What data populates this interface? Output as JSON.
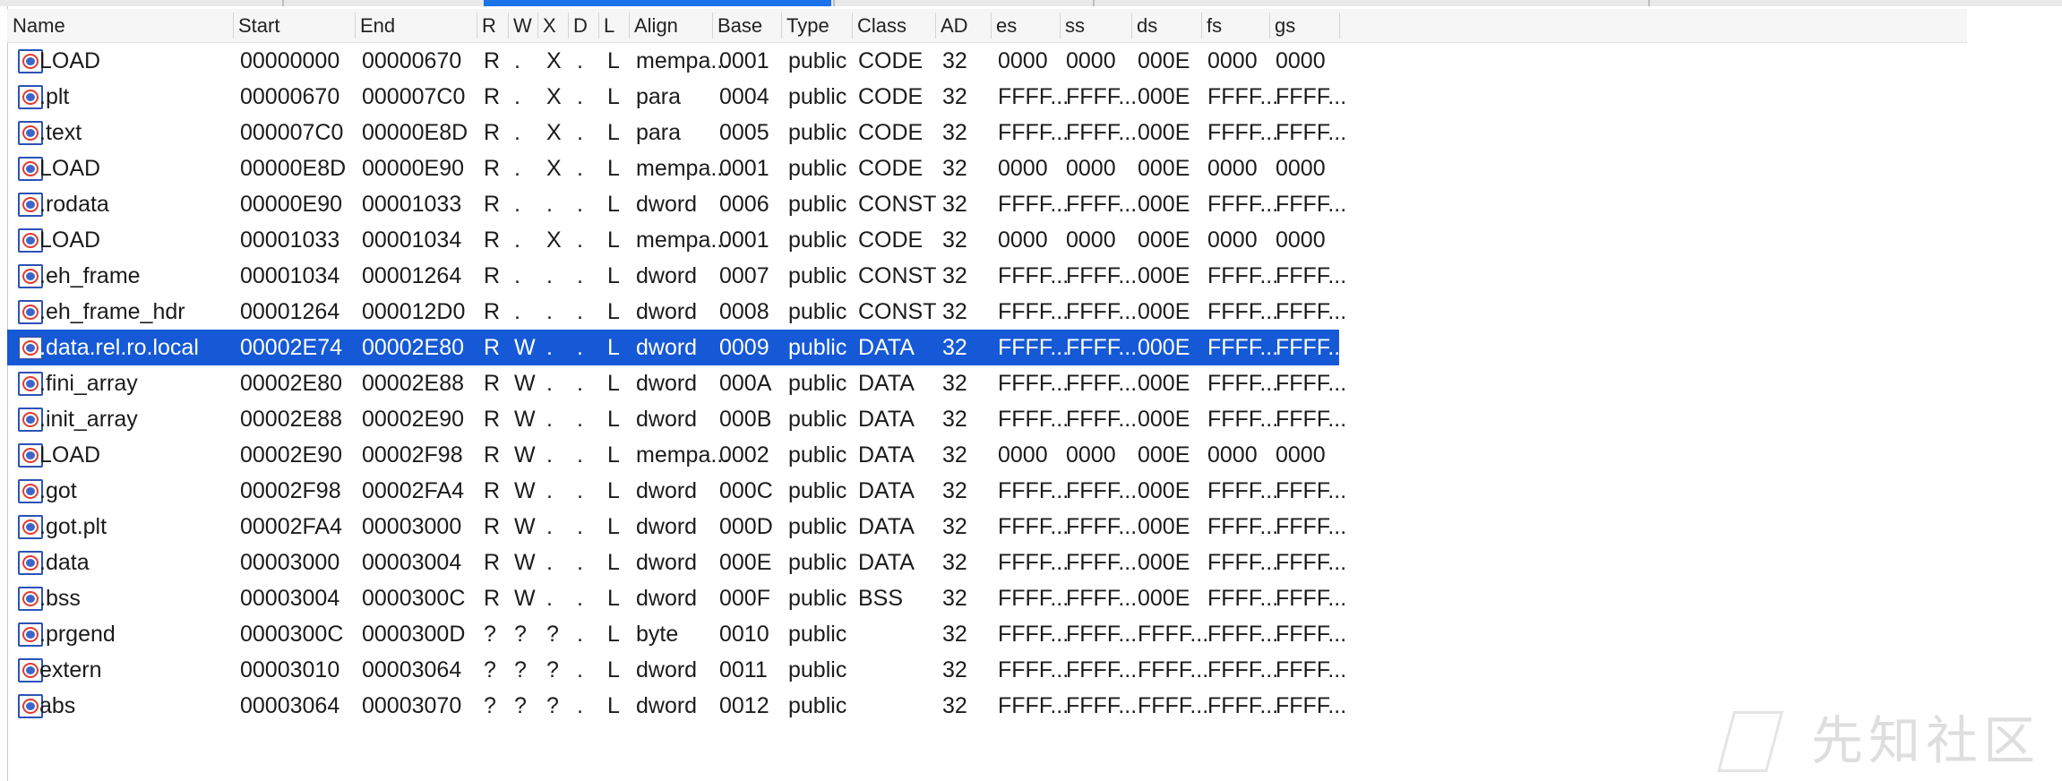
{
  "columns": [
    "Name",
    "Start",
    "End",
    "R",
    "W",
    "X",
    "D",
    "L",
    "Align",
    "Base",
    "Type",
    "Class",
    "AD",
    "es",
    "ss",
    "ds",
    "fs",
    "gs"
  ],
  "rows": [
    {
      "name": "LOAD",
      "start": "00000000",
      "end": "00000670",
      "r": "R",
      "w": ".",
      "x": "X",
      "d": ".",
      "l": "L",
      "align": "mempa...",
      "base": "0001",
      "type": "public",
      "class": "CODE",
      "ad": "32",
      "es": "0000",
      "ss": "0000",
      "ds": "000E",
      "fs": "0000",
      "gs": "0000"
    },
    {
      "name": ".plt",
      "start": "00000670",
      "end": "000007C0",
      "r": "R",
      "w": ".",
      "x": "X",
      "d": ".",
      "l": "L",
      "align": "para",
      "base": "0004",
      "type": "public",
      "class": "CODE",
      "ad": "32",
      "es": "FFFF...",
      "ss": "FFFF...",
      "ds": "000E",
      "fs": "FFFF...",
      "gs": "FFFF..."
    },
    {
      "name": ".text",
      "start": "000007C0",
      "end": "00000E8D",
      "r": "R",
      "w": ".",
      "x": "X",
      "d": ".",
      "l": "L",
      "align": "para",
      "base": "0005",
      "type": "public",
      "class": "CODE",
      "ad": "32",
      "es": "FFFF...",
      "ss": "FFFF...",
      "ds": "000E",
      "fs": "FFFF...",
      "gs": "FFFF..."
    },
    {
      "name": "LOAD",
      "start": "00000E8D",
      "end": "00000E90",
      "r": "R",
      "w": ".",
      "x": "X",
      "d": ".",
      "l": "L",
      "align": "mempa...",
      "base": "0001",
      "type": "public",
      "class": "CODE",
      "ad": "32",
      "es": "0000",
      "ss": "0000",
      "ds": "000E",
      "fs": "0000",
      "gs": "0000"
    },
    {
      "name": ".rodata",
      "start": "00000E90",
      "end": "00001033",
      "r": "R",
      "w": ".",
      "x": ".",
      "d": ".",
      "l": "L",
      "align": "dword",
      "base": "0006",
      "type": "public",
      "class": "CONST",
      "ad": "32",
      "es": "FFFF...",
      "ss": "FFFF...",
      "ds": "000E",
      "fs": "FFFF...",
      "gs": "FFFF..."
    },
    {
      "name": "LOAD",
      "start": "00001033",
      "end": "00001034",
      "r": "R",
      "w": ".",
      "x": "X",
      "d": ".",
      "l": "L",
      "align": "mempa...",
      "base": "0001",
      "type": "public",
      "class": "CODE",
      "ad": "32",
      "es": "0000",
      "ss": "0000",
      "ds": "000E",
      "fs": "0000",
      "gs": "0000"
    },
    {
      "name": ".eh_frame",
      "start": "00001034",
      "end": "00001264",
      "r": "R",
      "w": ".",
      "x": ".",
      "d": ".",
      "l": "L",
      "align": "dword",
      "base": "0007",
      "type": "public",
      "class": "CONST",
      "ad": "32",
      "es": "FFFF...",
      "ss": "FFFF...",
      "ds": "000E",
      "fs": "FFFF...",
      "gs": "FFFF..."
    },
    {
      "name": ".eh_frame_hdr",
      "start": "00001264",
      "end": "000012D0",
      "r": "R",
      "w": ".",
      "x": ".",
      "d": ".",
      "l": "L",
      "align": "dword",
      "base": "0008",
      "type": "public",
      "class": "CONST",
      "ad": "32",
      "es": "FFFF...",
      "ss": "FFFF...",
      "ds": "000E",
      "fs": "FFFF...",
      "gs": "FFFF..."
    },
    {
      "name": ".data.rel.ro.local",
      "start": "00002E74",
      "end": "00002E80",
      "r": "R",
      "w": "W",
      "x": ".",
      "d": ".",
      "l": "L",
      "align": "dword",
      "base": "0009",
      "type": "public",
      "class": "DATA",
      "ad": "32",
      "es": "FFFF...",
      "ss": "FFFF...",
      "ds": "000E",
      "fs": "FFFF...",
      "gs": "FFFF...",
      "selected": true
    },
    {
      "name": ".fini_array",
      "start": "00002E80",
      "end": "00002E88",
      "r": "R",
      "w": "W",
      "x": ".",
      "d": ".",
      "l": "L",
      "align": "dword",
      "base": "000A",
      "type": "public",
      "class": "DATA",
      "ad": "32",
      "es": "FFFF...",
      "ss": "FFFF...",
      "ds": "000E",
      "fs": "FFFF...",
      "gs": "FFFF..."
    },
    {
      "name": ".init_array",
      "start": "00002E88",
      "end": "00002E90",
      "r": "R",
      "w": "W",
      "x": ".",
      "d": ".",
      "l": "L",
      "align": "dword",
      "base": "000B",
      "type": "public",
      "class": "DATA",
      "ad": "32",
      "es": "FFFF...",
      "ss": "FFFF...",
      "ds": "000E",
      "fs": "FFFF...",
      "gs": "FFFF..."
    },
    {
      "name": "LOAD",
      "start": "00002E90",
      "end": "00002F98",
      "r": "R",
      "w": "W",
      "x": ".",
      "d": ".",
      "l": "L",
      "align": "mempa...",
      "base": "0002",
      "type": "public",
      "class": "DATA",
      "ad": "32",
      "es": "0000",
      "ss": "0000",
      "ds": "000E",
      "fs": "0000",
      "gs": "0000"
    },
    {
      "name": ".got",
      "start": "00002F98",
      "end": "00002FA4",
      "r": "R",
      "w": "W",
      "x": ".",
      "d": ".",
      "l": "L",
      "align": "dword",
      "base": "000C",
      "type": "public",
      "class": "DATA",
      "ad": "32",
      "es": "FFFF...",
      "ss": "FFFF...",
      "ds": "000E",
      "fs": "FFFF...",
      "gs": "FFFF..."
    },
    {
      "name": ".got.plt",
      "start": "00002FA4",
      "end": "00003000",
      "r": "R",
      "w": "W",
      "x": ".",
      "d": ".",
      "l": "L",
      "align": "dword",
      "base": "000D",
      "type": "public",
      "class": "DATA",
      "ad": "32",
      "es": "FFFF...",
      "ss": "FFFF...",
      "ds": "000E",
      "fs": "FFFF...",
      "gs": "FFFF..."
    },
    {
      "name": ".data",
      "start": "00003000",
      "end": "00003004",
      "r": "R",
      "w": "W",
      "x": ".",
      "d": ".",
      "l": "L",
      "align": "dword",
      "base": "000E",
      "type": "public",
      "class": "DATA",
      "ad": "32",
      "es": "FFFF...",
      "ss": "FFFF...",
      "ds": "000E",
      "fs": "FFFF...",
      "gs": "FFFF..."
    },
    {
      "name": ".bss",
      "start": "00003004",
      "end": "0000300C",
      "r": "R",
      "w": "W",
      "x": ".",
      "d": ".",
      "l": "L",
      "align": "dword",
      "base": "000F",
      "type": "public",
      "class": "BSS",
      "ad": "32",
      "es": "FFFF...",
      "ss": "FFFF...",
      "ds": "000E",
      "fs": "FFFF...",
      "gs": "FFFF..."
    },
    {
      "name": ".prgend",
      "start": "0000300C",
      "end": "0000300D",
      "r": "?",
      "w": "?",
      "x": "?",
      "d": ".",
      "l": "L",
      "align": "byte",
      "base": "0010",
      "type": "public",
      "class": "",
      "ad": "32",
      "es": "FFFF...",
      "ss": "FFFF...",
      "ds": "FFFF...",
      "fs": "FFFF...",
      "gs": "FFFF..."
    },
    {
      "name": "extern",
      "start": "00003010",
      "end": "00003064",
      "r": "?",
      "w": "?",
      "x": "?",
      "d": ".",
      "l": "L",
      "align": "dword",
      "base": "0011",
      "type": "public",
      "class": "",
      "ad": "32",
      "es": "FFFF...",
      "ss": "FFFF...",
      "ds": "FFFF...",
      "fs": "FFFF...",
      "gs": "FFFF..."
    },
    {
      "name": "abs",
      "start": "00003064",
      "end": "00003070",
      "r": "?",
      "w": "?",
      "x": "?",
      "d": ".",
      "l": "L",
      "align": "dword",
      "base": "0012",
      "type": "public",
      "class": "",
      "ad": "32",
      "es": "FFFF...",
      "ss": "FFFF...",
      "ds": "FFFF...",
      "fs": "FFFF...",
      "gs": "FFFF..."
    }
  ],
  "row_icon": "segment-icon",
  "watermark": "先知社区",
  "colors": {
    "selection": "#1559d6",
    "header_bg": "#f6f6f6",
    "icon_red": "#e23b2e",
    "icon_blue": "#2b52b5"
  }
}
